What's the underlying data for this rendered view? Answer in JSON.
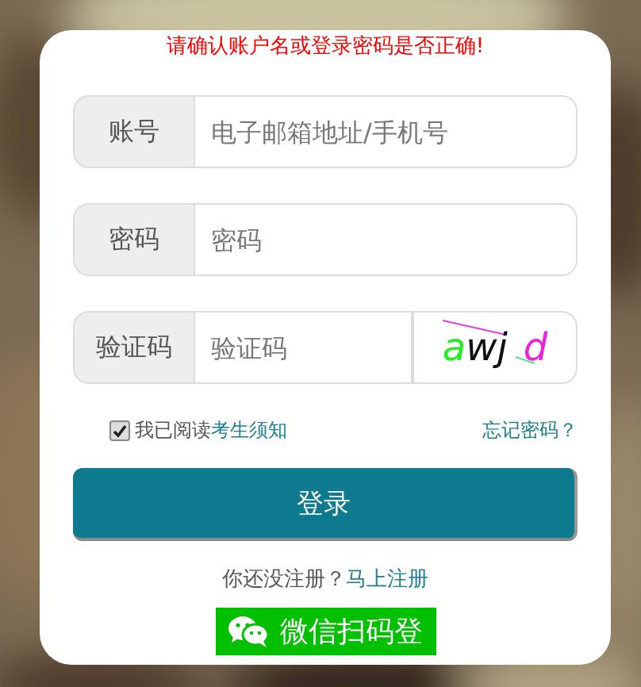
{
  "error_message": "请确认账户名或登录密码是否正确!",
  "fields": [
    {
      "label": "账号",
      "placeholder": "电子邮箱地址/手机号",
      "kind": "text"
    },
    {
      "label": "密码",
      "placeholder": "密码",
      "kind": "password"
    },
    {
      "label": "验证码",
      "placeholder": "验证码",
      "kind": "captcha",
      "captcha": [
        {
          "char": "a",
          "color": "#22ee22"
        },
        {
          "char": "w",
          "color": "#111111"
        },
        {
          "char": "j",
          "color": "#111111"
        },
        {
          "char": "d",
          "color": "#ee22dd"
        }
      ]
    }
  ],
  "agree": {
    "checked": true,
    "label": "我已阅读",
    "link": "考生须知"
  },
  "forgot_link": "忘记密码？",
  "login_button": "登录",
  "register": {
    "prompt": "你还没注册？",
    "link": "马上注册"
  },
  "wechat_button": "微信扫码登"
}
